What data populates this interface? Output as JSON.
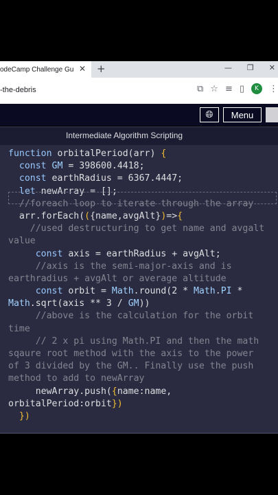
{
  "browser": {
    "tab_title": "odeCamp Challenge Guid",
    "tab_close": "✕",
    "new_tab": "+",
    "url": "-the-debris"
  },
  "nav": {
    "menu_label": "Menu"
  },
  "breadcrumb": "Intermediate Algorithm Scripting",
  "code_lines": [
    [
      {
        "t": "function ",
        "c": "kw"
      },
      {
        "t": "orbitalPeriod(arr) ",
        "c": "fn"
      },
      {
        "t": "{",
        "c": "yl"
      }
    ],
    [
      {
        "t": "  const ",
        "c": "kw"
      },
      {
        "t": "GM",
        "c": "cn"
      },
      {
        "t": " = ",
        "c": "fn"
      },
      {
        "t": "398600.4418",
        "c": "fn"
      },
      {
        "t": ";",
        "c": "fn"
      }
    ],
    [
      {
        "t": "  const ",
        "c": "kw"
      },
      {
        "t": "earthRadius = 6367.4447;",
        "c": "fn"
      }
    ],
    [
      {
        "t": "  let ",
        "c": "kw"
      },
      {
        "t": "newArray = [];",
        "c": "fn"
      }
    ],
    [
      {
        "t": "  //foreach loop to iterate through the array",
        "c": "cm"
      }
    ],
    [
      {
        "t": "  arr.forEach(",
        "c": "fn"
      },
      {
        "t": "(",
        "c": "yl"
      },
      {
        "t": "{name,avgAlt}",
        "c": "fn"
      },
      {
        "t": ")",
        "c": "yl"
      },
      {
        "t": "=>",
        "c": "fn"
      },
      {
        "t": "{",
        "c": "yl"
      }
    ],
    [
      {
        "t": "    //used destructuring to get name and avgalt",
        "c": "cm"
      }
    ],
    [
      {
        "t": "value",
        "c": "cm"
      }
    ],
    [
      {
        "t": "     const ",
        "c": "kw"
      },
      {
        "t": "axis = earthRadius + avgAlt;",
        "c": "fn"
      }
    ],
    [
      {
        "t": "     //axis is the semi-major-axis and is",
        "c": "cm"
      }
    ],
    [
      {
        "t": "earthradius + avgAlt or average altitude",
        "c": "cm"
      }
    ],
    [
      {
        "t": "     const ",
        "c": "kw"
      },
      {
        "t": "orbit = ",
        "c": "fn"
      },
      {
        "t": "Math",
        "c": "cn"
      },
      {
        "t": ".round(2 * ",
        "c": "fn"
      },
      {
        "t": "Math",
        "c": "cn"
      },
      {
        "t": ".",
        "c": "fn"
      },
      {
        "t": "PI",
        "c": "cn"
      },
      {
        "t": " *",
        "c": "fn"
      }
    ],
    [
      {
        "t": "Math",
        "c": "cn"
      },
      {
        "t": ".sqrt(axis ** 3 / ",
        "c": "fn"
      },
      {
        "t": "GM",
        "c": "cn"
      },
      {
        "t": "))",
        "c": "fn"
      }
    ],
    [
      {
        "t": "     //above is the calculation for the orbit",
        "c": "cm"
      }
    ],
    [
      {
        "t": "time",
        "c": "cm"
      }
    ],
    [
      {
        "t": "     // 2 x pi using Math.PI and then the math",
        "c": "cm"
      }
    ],
    [
      {
        "t": "sqaure root method with the axis to the power",
        "c": "cm"
      }
    ],
    [
      {
        "t": "of 3 divided by the GM.. Finally use the push",
        "c": "cm"
      }
    ],
    [
      {
        "t": "method to add to newArray",
        "c": "cm"
      }
    ],
    [
      {
        "t": "     newArray.push(",
        "c": "fn"
      },
      {
        "t": "{",
        "c": "yl"
      },
      {
        "t": "name:name,",
        "c": "fn"
      }
    ],
    [
      {
        "t": "orbitalPeriod:orbit",
        "c": "fn"
      },
      {
        "t": "})",
        "c": "yl"
      }
    ],
    [
      {
        "t": "  ",
        "c": "fn"
      },
      {
        "t": "})",
        "c": "yl"
      }
    ]
  ]
}
